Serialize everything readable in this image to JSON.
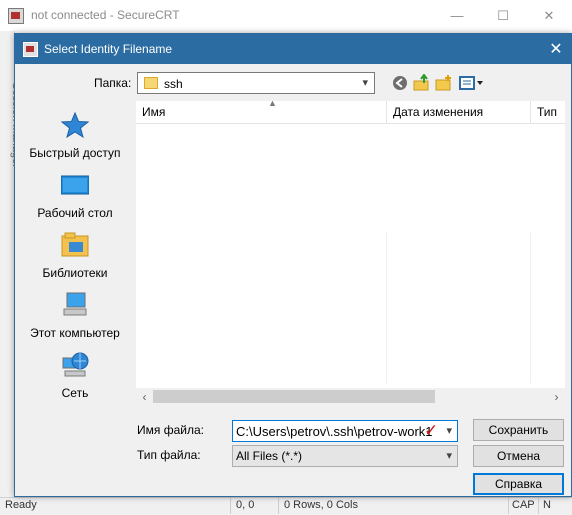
{
  "background_window": {
    "title": "not connected - SecureCRT",
    "minimize_glyph": "—",
    "maximize_glyph": "☐",
    "close_glyph": "✕",
    "session_manager_label": "Session Manager",
    "status": {
      "ready": "Ready",
      "position": "0, 0",
      "size": "0 Rows, 0 Cols",
      "caps": "CAP",
      "num": "N"
    }
  },
  "dialog": {
    "title": "Select Identity Filename",
    "close_glyph": "✕",
    "folder": {
      "label": "Папка:",
      "value": "ssh",
      "icon": "folder-icon"
    },
    "toolbar": {
      "back_icon": "back-icon",
      "up_icon": "up-folder-icon",
      "new_folder_icon": "new-folder-icon",
      "view_menu_icon": "view-menu-icon"
    },
    "places": [
      {
        "label": "Быстрый доступ",
        "icon": "star-icon"
      },
      {
        "label": "Рабочий стол",
        "icon": "desktop-icon"
      },
      {
        "label": "Библиотеки",
        "icon": "libraries-icon"
      },
      {
        "label": "Этот компьютер",
        "icon": "computer-icon"
      },
      {
        "label": "Сеть",
        "icon": "network-icon"
      }
    ],
    "columns": [
      "Имя",
      "Дата изменения",
      "Тип"
    ],
    "files": [],
    "filename": {
      "label": "Имя файла:",
      "value": "C:\\Users\\petrov\\.ssh\\petrov-work1"
    },
    "filetype": {
      "label": "Тип файла:",
      "value": "All Files (*.*)"
    },
    "buttons": {
      "save": "Сохранить",
      "cancel": "Отмена",
      "help": "Справка"
    },
    "colors": {
      "titlebar": "#2b6ca3",
      "accent": "#0078d7"
    }
  }
}
